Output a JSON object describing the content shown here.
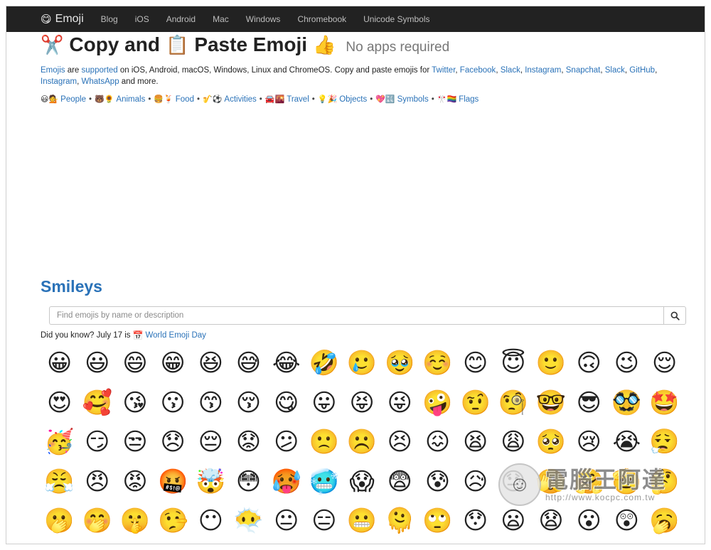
{
  "navbar": {
    "brand_icon": "😋",
    "brand": "Emoji",
    "links": [
      "Blog",
      "iOS",
      "Android",
      "Mac",
      "Windows",
      "Chromebook",
      "Unicode Symbols"
    ]
  },
  "headline": {
    "icon_scissors": "✂️",
    "copy_text": "Copy and",
    "icon_clipboard": "📋",
    "paste_text": "Paste Emoji",
    "icon_thumb": "👍",
    "subtitle": "No apps required"
  },
  "intro": {
    "emojis_link": "Emojis",
    "are": " are ",
    "supported_link": "supported",
    "platforms": " on iOS, Android, macOS, Windows, Linux and ChromeOS. Copy and paste emojis for ",
    "links": [
      "Twitter",
      "Facebook",
      "Slack",
      "Instagram",
      "Snapchat",
      "Slack",
      "GitHub",
      "Instagram",
      "WhatsApp"
    ],
    "suffix": " and more."
  },
  "categories": [
    {
      "emoji": "😃💁",
      "label": "People"
    },
    {
      "emoji": "🐻🌻",
      "label": "Animals"
    },
    {
      "emoji": "🍔🍹",
      "label": "Food"
    },
    {
      "emoji": "🎷⚽️",
      "label": "Activities"
    },
    {
      "emoji": "🚘🌇",
      "label": "Travel"
    },
    {
      "emoji": "💡🎉",
      "label": "Objects"
    },
    {
      "emoji": "💖🔣",
      "label": "Symbols"
    },
    {
      "emoji": "🎌🏳️‍🌈",
      "label": "Flags"
    }
  ],
  "section": {
    "title": "Smileys"
  },
  "search": {
    "placeholder": "Find emojis by name or description",
    "icon": "search-icon"
  },
  "did_you_know": {
    "prefix": "Did you know? July 17 is ",
    "calendar_icon": "📅",
    "link": "World Emoji Day"
  },
  "emojis": [
    "😀",
    "😃",
    "😄",
    "😁",
    "😆",
    "😅",
    "😂",
    "🤣",
    "🥲",
    "🥹",
    "☺️",
    "😊",
    "😇",
    "🙂",
    "🙃",
    "😉",
    "😌",
    "😍",
    "🥰",
    "😘",
    "😗",
    "😙",
    "😚",
    "😋",
    "😛",
    "😝",
    "😜",
    "🤪",
    "🤨",
    "🧐",
    "🤓",
    "😎",
    "🥸",
    "🤩",
    "🥳",
    "😏",
    "😒",
    "😞",
    "😔",
    "😟",
    "😕",
    "🙁",
    "☹️",
    "😣",
    "😖",
    "😫",
    "😩",
    "🥺",
    "😢",
    "😭",
    "😮‍💨",
    "😤",
    "😠",
    "😡",
    "🤬",
    "🤯",
    "😳",
    "🥵",
    "🥶",
    "😱",
    "😨",
    "😰",
    "😥",
    "😓",
    "🫣",
    "🤗",
    "🫡",
    "🤔",
    "🫢",
    "🤭",
    "🤫",
    "🤥",
    "😶",
    "😶‍🌫️",
    "😐",
    "😑",
    "😬",
    "🫠",
    "🙄",
    "😯",
    "😦",
    "😧",
    "😮",
    "😲",
    "🥱"
  ],
  "watermark": {
    "title": "電腦王阿達",
    "url": "http://www.kocpc.com.tw"
  }
}
